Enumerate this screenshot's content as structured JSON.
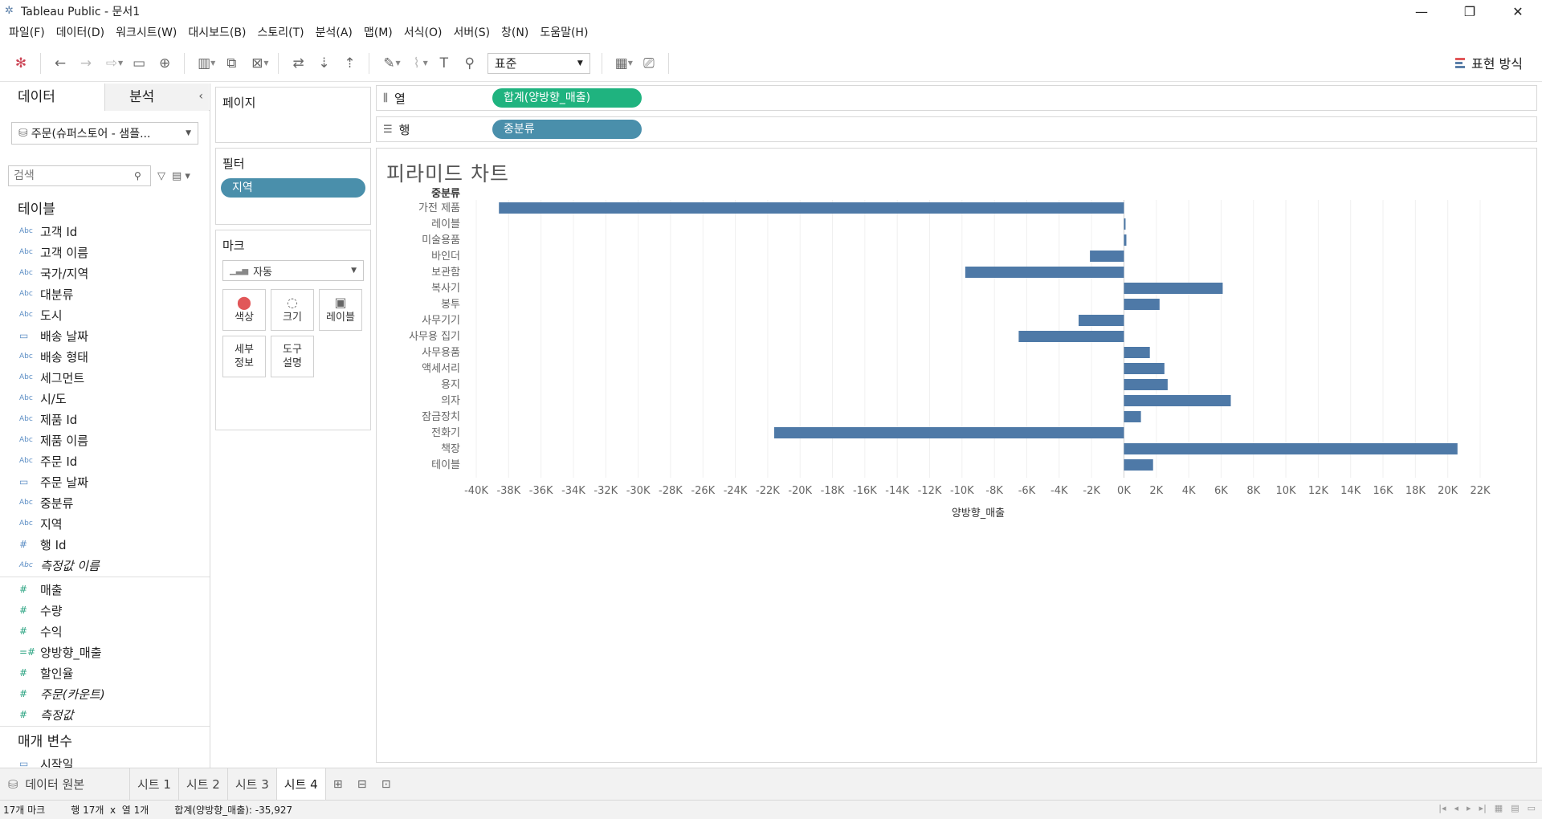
{
  "titlebar": {
    "title": "Tableau Public - 문서1",
    "minimize": "—",
    "restore": "❐",
    "close": "✕"
  },
  "menu": [
    "파일(F)",
    "데이터(D)",
    "워크시트(W)",
    "대시보드(B)",
    "스토리(T)",
    "분석(A)",
    "맵(M)",
    "서식(O)",
    "서버(S)",
    "창(N)",
    "도움말(H)"
  ],
  "toolbar": {
    "fit": "표준",
    "show_me": "표현 방식"
  },
  "leftpane": {
    "tab_data": "데이터",
    "tab_analytics": "분석",
    "datasource": "주문(슈퍼스토어 - 샘플...",
    "search_placeholder": "검색",
    "tables_header": "테이블",
    "dimensions": [
      {
        "type": "Abc",
        "name": "고객 Id"
      },
      {
        "type": "Abc",
        "name": "고객 이름"
      },
      {
        "type": "Abc",
        "name": "국가/지역"
      },
      {
        "type": "Abc",
        "name": "대분류"
      },
      {
        "type": "Abc",
        "name": "도시"
      },
      {
        "type": "date",
        "name": "배송 날짜"
      },
      {
        "type": "Abc",
        "name": "배송 형태"
      },
      {
        "type": "Abc",
        "name": "세그먼트"
      },
      {
        "type": "Abc",
        "name": "시/도"
      },
      {
        "type": "Abc",
        "name": "제품 Id"
      },
      {
        "type": "Abc",
        "name": "제품 이름"
      },
      {
        "type": "Abc",
        "name": "주문 Id"
      },
      {
        "type": "date",
        "name": "주문 날짜"
      },
      {
        "type": "Abc",
        "name": "중분류"
      },
      {
        "type": "Abc",
        "name": "지역"
      },
      {
        "type": "#",
        "name": "행 Id"
      },
      {
        "type": "Abc",
        "name": "측정값 이름",
        "italic": true
      }
    ],
    "measures": [
      {
        "type": "#",
        "name": "매출"
      },
      {
        "type": "#",
        "name": "수량"
      },
      {
        "type": "#",
        "name": "수익"
      },
      {
        "type": "=#",
        "name": "양방향_매출"
      },
      {
        "type": "#",
        "name": "할인율"
      },
      {
        "type": "#",
        "name": "주문(카운트)",
        "italic": true
      },
      {
        "type": "#",
        "name": "측정값",
        "italic": true
      }
    ],
    "params_header": "매개 변수",
    "params": [
      {
        "type": "date",
        "name": "시작일"
      }
    ]
  },
  "shelves": {
    "pages_label": "페이지",
    "filters_label": "필터",
    "filter_pill": "지역",
    "marks_label": "마크",
    "marks_type": "자동",
    "mark_buttons": [
      "색상",
      "크기",
      "레이블",
      "세부\n정보",
      "도구\n설명"
    ],
    "columns_label": "열",
    "columns_pill": "합계(양방향_매출)",
    "rows_label": "행",
    "rows_pill": "중분류"
  },
  "view": {
    "sheet_title": "피라미드 차트"
  },
  "chart_data": {
    "type": "bar",
    "orientation": "horizontal",
    "header": "중분류",
    "xlabel": "양방향_매출",
    "xlim": [
      -40000,
      22000
    ],
    "xticks": [
      "-40K",
      "-38K",
      "-36K",
      "-34K",
      "-32K",
      "-30K",
      "-28K",
      "-26K",
      "-24K",
      "-22K",
      "-20K",
      "-18K",
      "-16K",
      "-14K",
      "-12K",
      "-10K",
      "-8K",
      "-6K",
      "-4K",
      "-2K",
      "0K",
      "2K",
      "4K",
      "6K",
      "8K",
      "10K",
      "12K",
      "14K",
      "16K",
      "18K",
      "20K",
      "22K"
    ],
    "categories": [
      "가전 제품",
      "레이블",
      "미술용품",
      "바인더",
      "보관함",
      "복사기",
      "봉투",
      "사무기기",
      "사무용 집기",
      "사무용품",
      "액세서리",
      "용지",
      "의자",
      "잠금장치",
      "전화기",
      "책장",
      "테이블"
    ],
    "values": [
      -38600,
      100,
      150,
      -2100,
      -9800,
      6100,
      2200,
      -2800,
      -6500,
      1600,
      2500,
      2700,
      6600,
      1050,
      -21600,
      20600,
      1800
    ],
    "bar_color": "#4e79a7"
  },
  "sheettabs": {
    "source": "데이터 원본",
    "sheets": [
      "시트 1",
      "시트 2",
      "시트 3",
      "시트 4"
    ],
    "active": 3
  },
  "status": {
    "marks": "17개 마크",
    "rowscols": "행 17개  x  열 1개",
    "sum": "합계(양방향_매출): -35,927"
  }
}
